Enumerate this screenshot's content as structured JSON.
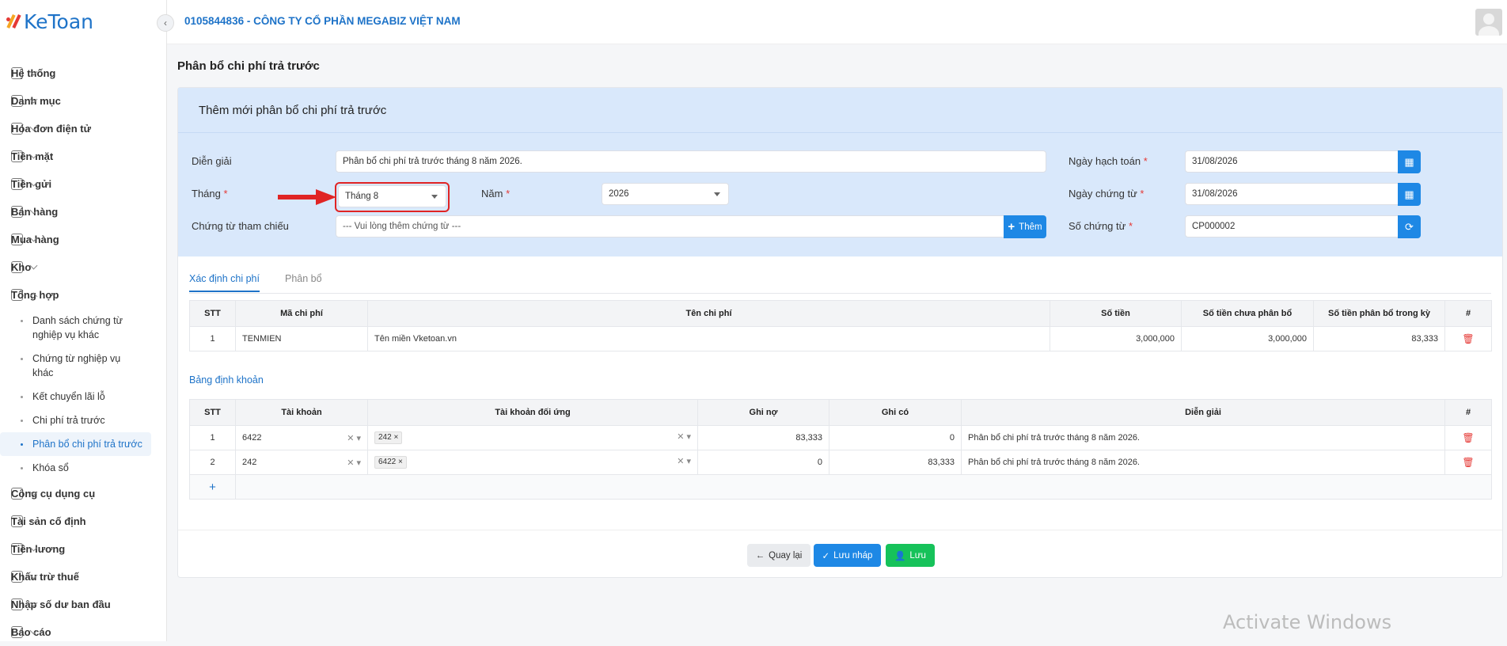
{
  "app": {
    "logo": "KeToan",
    "company": "0105844836 - CÔNG TY CỔ PHẦN MEGABIZ VIỆT NAM",
    "collapse_icon": "‹"
  },
  "sidebar": {
    "items_top": [
      {
        "label": "Hệ thống",
        "icon": "gear-icon"
      },
      {
        "label": "Danh mục",
        "icon": "grid-icon"
      },
      {
        "label": "Hóa đơn điện tử",
        "icon": "invoice-icon"
      },
      {
        "label": "Tiền mặt",
        "icon": "cash-icon"
      },
      {
        "label": "Tiền gửi",
        "icon": "card-icon"
      },
      {
        "label": "Bán hàng",
        "icon": "sale-icon"
      },
      {
        "label": "Mua hàng",
        "icon": "cart-icon"
      },
      {
        "label": "Kho",
        "icon": "warehouse-icon"
      },
      {
        "label": "Tổng hợp",
        "icon": "chart-icon"
      }
    ],
    "subitems": [
      {
        "label": "Danh sách chứng từ nghiệp vụ khác"
      },
      {
        "label": "Chứng từ nghiệp vụ khác"
      },
      {
        "label": "Kết chuyển lãi lỗ"
      },
      {
        "label": "Chi phí trả trước"
      },
      {
        "label": "Phân bổ chi phí trả trước"
      },
      {
        "label": "Khóa sổ"
      }
    ],
    "items_bottom": [
      {
        "label": "Công cụ dụng cụ",
        "icon": "tools-icon"
      },
      {
        "label": "Tài sản cố định",
        "icon": "asset-icon"
      },
      {
        "label": "Tiền lương",
        "icon": "salary-icon"
      },
      {
        "label": "Khấu trừ thuế",
        "icon": "tax-icon"
      },
      {
        "label": "Nhập số dư ban đầu",
        "icon": "balance-icon"
      },
      {
        "label": "Báo cáo",
        "icon": "report-icon"
      }
    ]
  },
  "page": {
    "title": "Phân bổ chi phí trả trước"
  },
  "form": {
    "card_title": "Thêm mới phân bổ chi phí trả trước",
    "dien_giai_label": "Diễn giải",
    "dien_giai_value": "Phân bổ chi phí trả trước tháng 8 năm 2026.",
    "thang_label": "Tháng",
    "thang_value": "Tháng 8",
    "nam_label": "Năm",
    "nam_value": "2026",
    "chung_tu_label": "Chứng từ tham chiếu",
    "chung_tu_placeholder": "--- Vui lòng thêm chứng từ ---",
    "them_label": "Thêm",
    "ngay_hach_toan_label": "Ngày hạch toán",
    "ngay_hach_toan_value": "31/08/2026",
    "ngay_chung_tu_label": "Ngày chứng từ",
    "ngay_chung_tu_value": "31/08/2026",
    "so_chung_tu_label": "Số chứng từ",
    "so_chung_tu_value": "CP000002",
    "required_mark": "*"
  },
  "tabs": [
    {
      "label": "Xác định chi phí"
    },
    {
      "label": "Phân bổ"
    }
  ],
  "expense_table": {
    "headers": [
      "STT",
      "Mã chi phí",
      "Tên chi phí",
      "Số tiền",
      "Số tiền chưa phân bổ",
      "Số tiền phân bổ trong kỳ",
      "#"
    ],
    "rows": [
      {
        "stt": "1",
        "ma": "TENMIEN",
        "ten": "Tên miền Vketoan.vn",
        "so_tien": "3,000,000",
        "chua_phan_bo": "3,000,000",
        "phan_bo": "83,333"
      }
    ]
  },
  "entries": {
    "title": "Bảng định khoản",
    "headers": [
      "STT",
      "Tài khoản",
      "Tài khoản đối ứng",
      "Ghi nợ",
      "Ghi có",
      "Diễn giải",
      "#"
    ],
    "rows": [
      {
        "stt": "1",
        "tk": "6422",
        "doi_ung": "242",
        "no": "83,333",
        "co": "0",
        "dien_giai": "Phân bổ chi phí trả trước tháng 8 năm 2026."
      },
      {
        "stt": "2",
        "tk": "242",
        "doi_ung": "6422",
        "no": "0",
        "co": "83,333",
        "dien_giai": "Phân bổ chi phí trả trước tháng 8 năm 2026."
      }
    ],
    "add_label": "+"
  },
  "buttons": {
    "back": "Quay lại",
    "draft": "Lưu nháp",
    "save": "Lưu"
  },
  "watermark": "Activate Windows",
  "colors": {
    "accent": "#1e88e5",
    "success": "#16c25a",
    "danger": "#e53935",
    "form_bg": "#d9e8fb"
  }
}
